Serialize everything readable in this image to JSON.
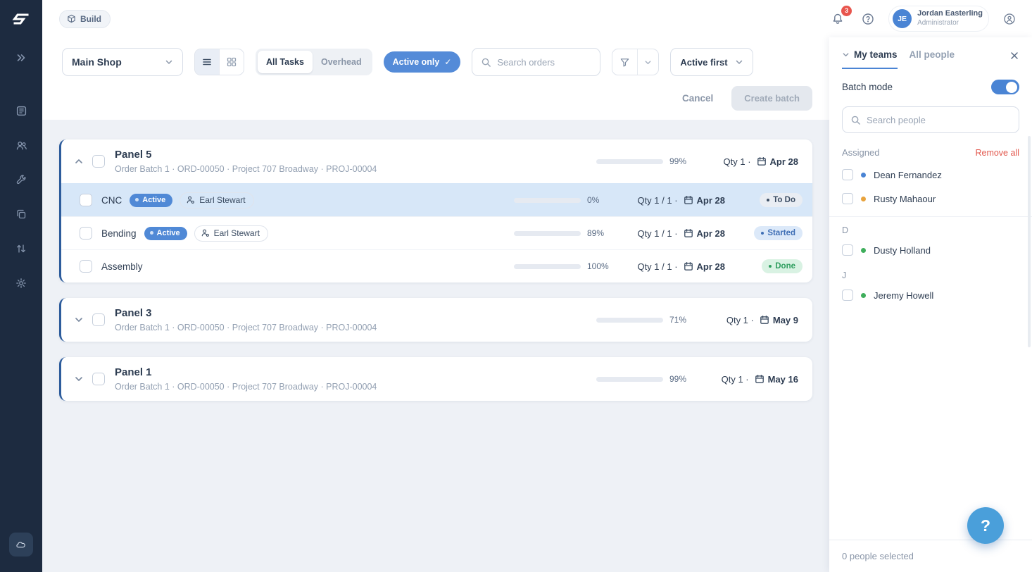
{
  "colors": {
    "accent_blue": "#4a84d4",
    "sidebar_bg": "#1d2b40",
    "selected_row_bg": "#d7e7f8",
    "progress_fill": "#8093b3",
    "done_green": "#2f9e5f",
    "started_blue": "#3f6fb5",
    "remove_red": "#e2574c",
    "notification_red": "#e8554d",
    "help_fab_blue": "#4a9fda"
  },
  "sidebar": {
    "icons": [
      "double-chevron-right",
      "board",
      "users",
      "wrench",
      "copy",
      "sort-arrows",
      "gear",
      "workspace-badge"
    ]
  },
  "header": {
    "build_label": "Build",
    "notification_count": "3",
    "user_initials": "JE",
    "user_name": "Jordan Easterling",
    "user_role": "Administrator"
  },
  "toolbar": {
    "shop_select": "Main Shop",
    "tab_all_tasks": "All Tasks",
    "tab_overhead": "Overhead",
    "active_only": "Active only",
    "active_only_check": "✓",
    "search_placeholder": "Search orders",
    "sort_select": "Active first",
    "cancel": "Cancel",
    "create_batch": "Create batch"
  },
  "panels": [
    {
      "title": "Panel 5",
      "subtitle": "Order Batch 1 · ORD-00050 · Project 707 Broadway · PROJ-00004",
      "progress": 99,
      "progress_label": "99%",
      "qty_label": "Qty 1 ·",
      "date": "Apr 28",
      "expanded": true,
      "tasks": [
        {
          "name": "CNC",
          "badge": "Active",
          "assignee": "Earl Stewart",
          "progress": 0,
          "progress_label": "0%",
          "qty_label": "Qty 1 / 1 ·",
          "date": "Apr 28",
          "status": "To Do",
          "selected": true
        },
        {
          "name": "Bending",
          "badge": "Active",
          "assignee": "Earl Stewart",
          "progress": 89,
          "progress_label": "89%",
          "qty_label": "Qty 1 / 1 ·",
          "date": "Apr 28",
          "status": "Started",
          "selected": false
        },
        {
          "name": "Assembly",
          "progress": 100,
          "progress_label": "100%",
          "qty_label": "Qty 1 / 1 ·",
          "date": "Apr 28",
          "status": "Done",
          "selected": false
        }
      ]
    },
    {
      "title": "Panel 3",
      "subtitle": "Order Batch 1 · ORD-00050 · Project 707 Broadway · PROJ-00004",
      "progress": 71,
      "progress_label": "71%",
      "qty_label": "Qty 1 ·",
      "date": "May 9",
      "expanded": false
    },
    {
      "title": "Panel 1",
      "subtitle": "Order Batch 1 · ORD-00050 · Project 707 Broadway · PROJ-00004",
      "progress": 99,
      "progress_label": "99%",
      "qty_label": "Qty 1 ·",
      "date": "May 16",
      "expanded": false
    }
  ],
  "people_panel": {
    "tab_my_teams": "My teams",
    "tab_all_people": "All people",
    "batch_mode": "Batch mode",
    "batch_mode_on": true,
    "search_placeholder": "Search people",
    "assigned": "Assigned",
    "remove_all": "Remove all",
    "assigned_people": [
      {
        "name": "Dean Fernandez",
        "dot": "#4a84d4"
      },
      {
        "name": "Rusty Mahaour",
        "dot": "#e8a33d"
      }
    ],
    "groups": [
      {
        "letter": "D",
        "people": [
          {
            "name": "Dusty Holland",
            "dot": "#3fae5c"
          }
        ]
      },
      {
        "letter": "J",
        "people": [
          {
            "name": "Jeremy Howell",
            "dot": "#3fae5c"
          }
        ]
      }
    ],
    "footer": "0 people selected",
    "help": "?"
  }
}
